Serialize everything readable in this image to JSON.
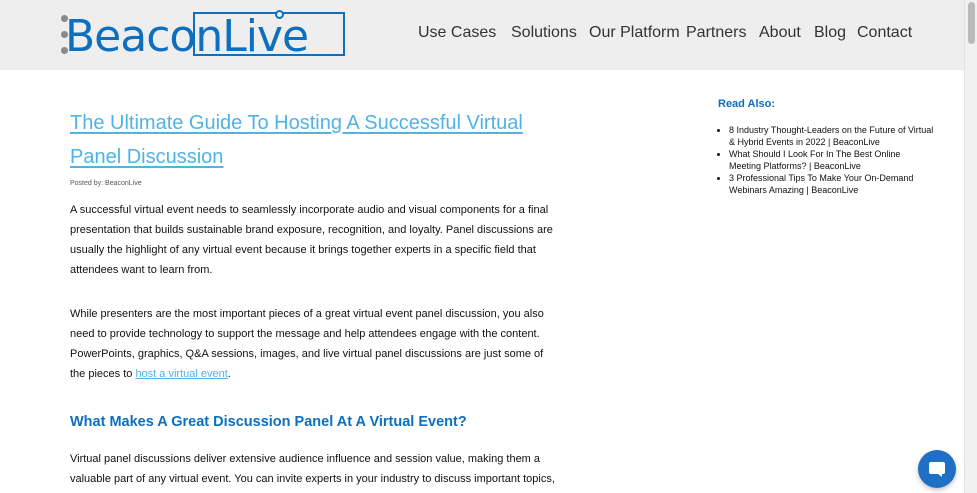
{
  "header": {
    "logo_text": "BeaconLive",
    "nav": [
      "Use Cases",
      "Solutions",
      "Our Platform",
      "Partners",
      "About",
      "Blog",
      "Contact"
    ]
  },
  "article": {
    "title": "The Ultimate Guide To Hosting A Successful Virtual Panel Discussion",
    "posted_by": "Posted by: BeaconLive",
    "paragraph1": "A successful virtual event needs to seamlessly incorporate audio and visual components for a final presentation that builds sustainable brand exposure, recognition, and loyalty. Panel discussions are usually the highlight of any virtual event because it brings together experts in a specific field that attendees want to learn from.",
    "paragraph2_before_link": "While presenters are the most important pieces of a great virtual event panel discussion, you also need to provide technology to support the message and help attendees engage with the content. PowerPoints, graphics, Q&A sessions, images, and live virtual panel discussions are just some of the pieces to ",
    "paragraph2_link": "host a virtual event",
    "paragraph2_after_link": ".",
    "heading2": "What Makes A Great Discussion Panel At A Virtual Event?",
    "paragraph3": "Virtual panel discussions deliver extensive audience influence and session value, making them a valuable part of any virtual event. You can invite experts in your industry to discuss important topics,"
  },
  "sidebar": {
    "heading": "Read Also:",
    "links": [
      "8 Industry Thought-Leaders on the Future of Virtual & Hybrid Events in 2022 | BeaconLive",
      "What Should I Look For In The Best Online Meeting Platforms? | BeaconLive",
      "3 Professional Tips To Make Your On-Demand Webinars Amazing | BeaconLive"
    ]
  },
  "colors": {
    "brand_blue": "#0d6fbd",
    "link_blue": "#4fb3e8",
    "header_bg": "#eeeeee"
  },
  "icons": {
    "chat": "chat-bubble-icon"
  }
}
